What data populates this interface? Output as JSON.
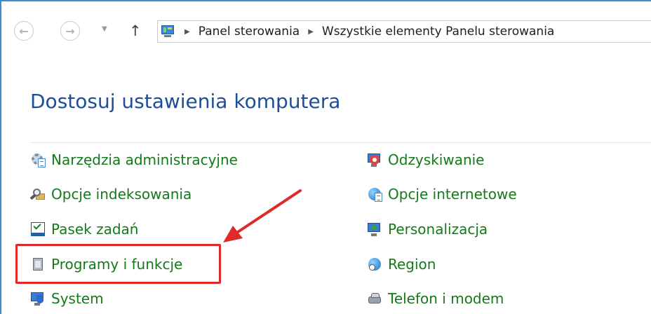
{
  "address_bar": {
    "back_glyph": "←",
    "forward_glyph": "→",
    "recent_glyph": "▼",
    "up_glyph": "↑",
    "separator_glyph": "▶",
    "breadcrumbs": [
      "Panel sterowania",
      "Wszystkie elementy Panelu sterowania"
    ]
  },
  "page": {
    "title": "Dostosuj ustawienia komputera"
  },
  "items": {
    "left": [
      {
        "label": "Narzędzia administracyjne",
        "icon": "admin-tools-icon"
      },
      {
        "label": "Opcje indeksowania",
        "icon": "indexing-options-icon"
      },
      {
        "label": "Pasek zadań",
        "icon": "taskbar-icon"
      },
      {
        "label": "Programy i funkcje",
        "icon": "programs-features-icon"
      },
      {
        "label": "System",
        "icon": "system-icon"
      }
    ],
    "right": [
      {
        "label": "Odzyskiwanie",
        "icon": "recovery-icon"
      },
      {
        "label": "Opcje internetowe",
        "icon": "internet-options-icon"
      },
      {
        "label": "Personalizacja",
        "icon": "personalization-icon"
      },
      {
        "label": "Region",
        "icon": "region-icon"
      },
      {
        "label": "Telefon i modem",
        "icon": "phone-modem-icon"
      }
    ]
  },
  "colors": {
    "link": "#137a18",
    "title": "#1d4e9a",
    "highlight": "#e02a2a"
  }
}
